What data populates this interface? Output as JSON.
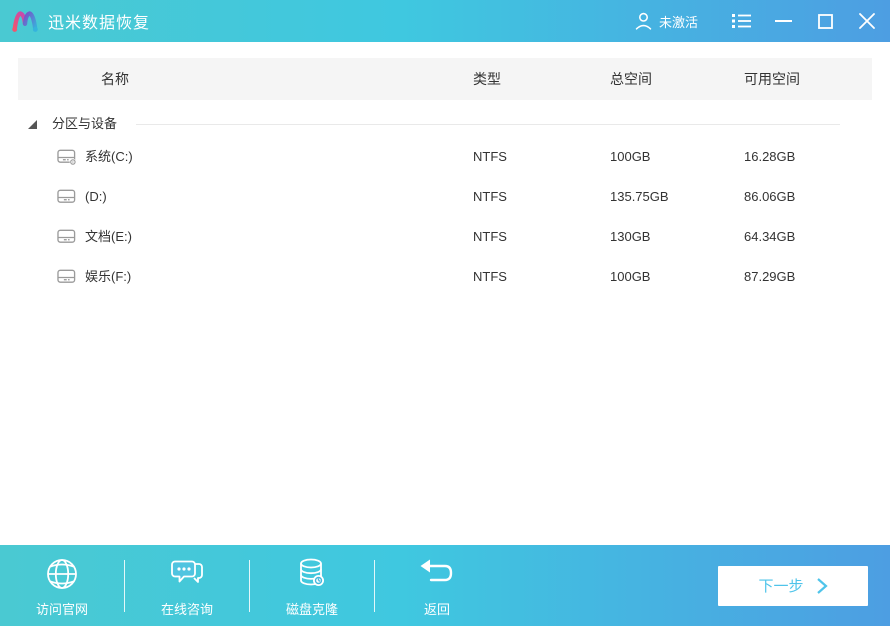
{
  "colors": {
    "bar_gradient_left": "#4ac9d2",
    "bar_gradient_right": "#4d9ee2",
    "table_header_bg": "#f5f5f5",
    "text_dark": "#333333",
    "drive_icon_gray": "#9a9a9a",
    "accent_cyan": "#4fc4ea",
    "logo_pink": "#ef4a7f",
    "logo_blue": "#3f8fd8"
  },
  "titlebar": {
    "app_title": "迅米数据恢复",
    "activation_status": "未激活",
    "icons": [
      "logo-m",
      "user-icon",
      "task-list-icon",
      "minimize-icon",
      "maximize-icon",
      "close-icon"
    ]
  },
  "table": {
    "headers": [
      "名称",
      "类型",
      "总空间",
      "可用空间"
    ],
    "group_label": "分区与设备",
    "group_expanded": true,
    "rows": [
      {
        "icon": "system-drive-icon",
        "name": "系统(C:)",
        "type": "NTFS",
        "total": "100GB",
        "free": "16.28GB"
      },
      {
        "icon": "drive-icon",
        "name": "(D:)",
        "type": "NTFS",
        "total": "135.75GB",
        "free": "86.06GB"
      },
      {
        "icon": "drive-icon",
        "name": "文档(E:)",
        "type": "NTFS",
        "total": "130GB",
        "free": "64.34GB"
      },
      {
        "icon": "drive-icon",
        "name": "娱乐(F:)",
        "type": "NTFS",
        "total": "100GB",
        "free": "87.29GB"
      }
    ]
  },
  "bottombar": {
    "actions": [
      {
        "icon": "globe-icon",
        "label": "访问官网"
      },
      {
        "icon": "chat-icon",
        "label": "在线咨询"
      },
      {
        "icon": "disk-clone-icon",
        "label": "磁盘克隆"
      },
      {
        "icon": "return-icon",
        "label": "返回"
      }
    ],
    "next_label": "下一步"
  }
}
